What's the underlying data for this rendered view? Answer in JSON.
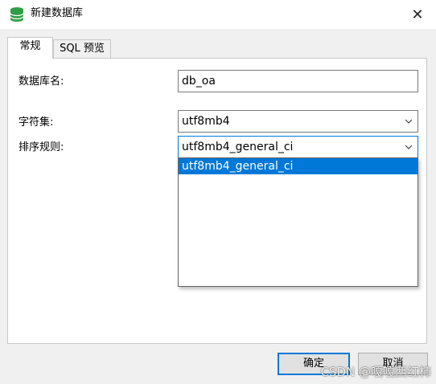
{
  "window": {
    "title": "新建数据库",
    "icon": "database-icon",
    "close_glyph": "✕"
  },
  "tabs": [
    {
      "label": "常规",
      "active": true
    },
    {
      "label": "SQL 预览",
      "active": false
    }
  ],
  "form": {
    "name_label": "数据库名:",
    "name_value": "db_oa",
    "charset_label": "字符集:",
    "charset_value": "utf8mb4",
    "collation_label": "排序规则:",
    "collation_value": "utf8mb4_general_ci"
  },
  "collation_dropdown": {
    "options": [
      "utf8mb4_general_ci"
    ],
    "highlighted": "utf8mb4_general_ci"
  },
  "buttons": {
    "ok_label": "确定",
    "cancel_label": "取消"
  },
  "watermark": "CSDN @嘎嘎西红柿",
  "colors": {
    "accent": "#0078d7",
    "icon_green": "#2e9e45"
  }
}
